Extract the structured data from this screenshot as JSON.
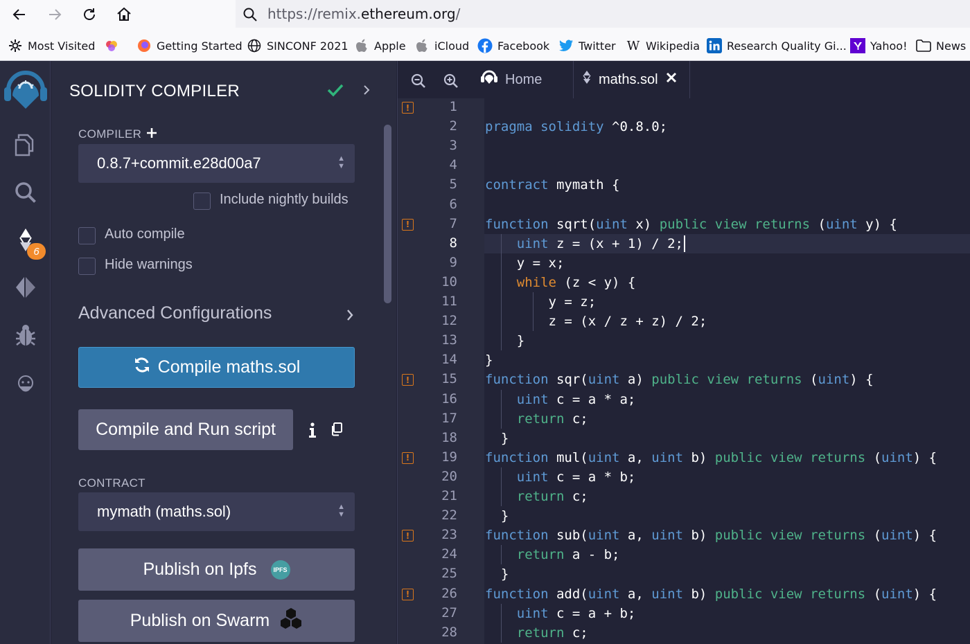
{
  "browser": {
    "url_prefix": "https://remix.",
    "url_domain": "ethereum.org",
    "url_suffix": "/",
    "bookmarks": [
      "Most Visited",
      "Getting Started",
      "SINCONF 2021",
      "Apple",
      "iCloud",
      "Facebook",
      "Twitter",
      "Wikipedia",
      "Research Quality Gi...",
      "Yahoo!",
      "News"
    ]
  },
  "iconbar": {
    "badge": "6"
  },
  "panel": {
    "title": "SOLIDITY COMPILER",
    "compiler_label": "COMPILER",
    "compiler_version": "0.8.7+commit.e28d00a7",
    "nightly_label": "Include nightly builds",
    "auto_compile_label": "Auto compile",
    "hide_warnings_label": "Hide warnings",
    "advanced_label": "Advanced Configurations",
    "compile_button": "Compile maths.sol",
    "compile_run_button": "Compile and Run script",
    "contract_label": "CONTRACT",
    "contract_value": "mymath (maths.sol)",
    "publish_ipfs": "Publish on Ipfs",
    "ipfs_logo": "IPFS",
    "publish_swarm": "Publish on Swarm"
  },
  "editor": {
    "tabs": [
      {
        "label": "Home"
      },
      {
        "label": "maths.sol"
      }
    ],
    "warning_lines": [
      1,
      7,
      15,
      19,
      23,
      26
    ],
    "active_line": 8,
    "line_numbers": [
      "1",
      "2",
      "3",
      "4",
      "5",
      "6",
      "7",
      "8",
      "9",
      "10",
      "11",
      "12",
      "13",
      "14",
      "15",
      "16",
      "17",
      "18",
      "19",
      "20",
      "21",
      "22",
      "23",
      "24",
      "25",
      "26",
      "27",
      "28"
    ],
    "code_lines": [
      [],
      [
        [
          "kb",
          "pragma solidity "
        ],
        [
          "",
          "^0.8.0;"
        ]
      ],
      [],
      [],
      [
        [
          "kb",
          "contract "
        ],
        [
          "",
          "mymath {"
        ]
      ],
      [],
      [
        [
          "kb",
          "function "
        ],
        [
          "",
          "sqrt("
        ],
        [
          "kb",
          "uint "
        ],
        [
          "",
          "x) "
        ],
        [
          "kg",
          "public view "
        ],
        [
          "kg",
          "returns "
        ],
        [
          "",
          "("
        ],
        [
          "kb",
          "uint "
        ],
        [
          "",
          "y) {"
        ]
      ],
      [
        [
          "",
          "    "
        ],
        [
          "kb",
          "uint "
        ],
        [
          "",
          "z = (x + 1) / 2;"
        ]
      ],
      [
        [
          "",
          "    y = x;"
        ]
      ],
      [
        [
          "",
          "    "
        ],
        [
          "ko",
          "while "
        ],
        [
          "",
          "(z < y) {"
        ]
      ],
      [
        [
          "",
          "        y = z;"
        ]
      ],
      [
        [
          "",
          "        z = (x / z + z) / 2;"
        ]
      ],
      [
        [
          "",
          "    }"
        ]
      ],
      [
        [
          "",
          "}"
        ]
      ],
      [
        [
          "kb",
          "function "
        ],
        [
          "",
          "sqr("
        ],
        [
          "kb",
          "uint "
        ],
        [
          "",
          "a) "
        ],
        [
          "kg",
          "public view "
        ],
        [
          "kg",
          "returns "
        ],
        [
          "",
          "("
        ],
        [
          "kb",
          "uint"
        ],
        [
          "",
          ") {"
        ]
      ],
      [
        [
          "",
          "    "
        ],
        [
          "kb",
          "uint "
        ],
        [
          "",
          "c = a * a;"
        ]
      ],
      [
        [
          "",
          "    "
        ],
        [
          "kg",
          "return "
        ],
        [
          "",
          "c;"
        ]
      ],
      [
        [
          "",
          "  }"
        ]
      ],
      [
        [
          "kb",
          "function "
        ],
        [
          "",
          "mul("
        ],
        [
          "kb",
          "uint "
        ],
        [
          "",
          "a, "
        ],
        [
          "kb",
          "uint "
        ],
        [
          "",
          "b) "
        ],
        [
          "kg",
          "public view "
        ],
        [
          "kg",
          "returns "
        ],
        [
          "",
          "("
        ],
        [
          "kb",
          "uint"
        ],
        [
          "",
          ") {"
        ]
      ],
      [
        [
          "",
          "    "
        ],
        [
          "kb",
          "uint "
        ],
        [
          "",
          "c = a * b;"
        ]
      ],
      [
        [
          "",
          "    "
        ],
        [
          "kg",
          "return "
        ],
        [
          "",
          "c;"
        ]
      ],
      [
        [
          "",
          "  }"
        ]
      ],
      [
        [
          "kb",
          "function "
        ],
        [
          "",
          "sub("
        ],
        [
          "kb",
          "uint "
        ],
        [
          "",
          "a, "
        ],
        [
          "kb",
          "uint "
        ],
        [
          "",
          "b) "
        ],
        [
          "kg",
          "public view "
        ],
        [
          "kg",
          "returns "
        ],
        [
          "",
          "("
        ],
        [
          "kb",
          "uint"
        ],
        [
          "",
          ") {"
        ]
      ],
      [
        [
          "",
          "    "
        ],
        [
          "kg",
          "return "
        ],
        [
          "",
          "a - b;"
        ]
      ],
      [
        [
          "",
          "  }"
        ]
      ],
      [
        [
          "kb",
          "function "
        ],
        [
          "",
          "add("
        ],
        [
          "kb",
          "uint "
        ],
        [
          "",
          "a, "
        ],
        [
          "kb",
          "uint "
        ],
        [
          "",
          "b) "
        ],
        [
          "kg",
          "public view "
        ],
        [
          "kg",
          "returns "
        ],
        [
          "",
          "("
        ],
        [
          "kb",
          "uint"
        ],
        [
          "",
          ") {"
        ]
      ],
      [
        [
          "",
          "    "
        ],
        [
          "kb",
          "uint "
        ],
        [
          "",
          "c = a + b;"
        ]
      ],
      [
        [
          "",
          "    "
        ],
        [
          "kg",
          "return "
        ],
        [
          "",
          "c;"
        ]
      ]
    ]
  }
}
